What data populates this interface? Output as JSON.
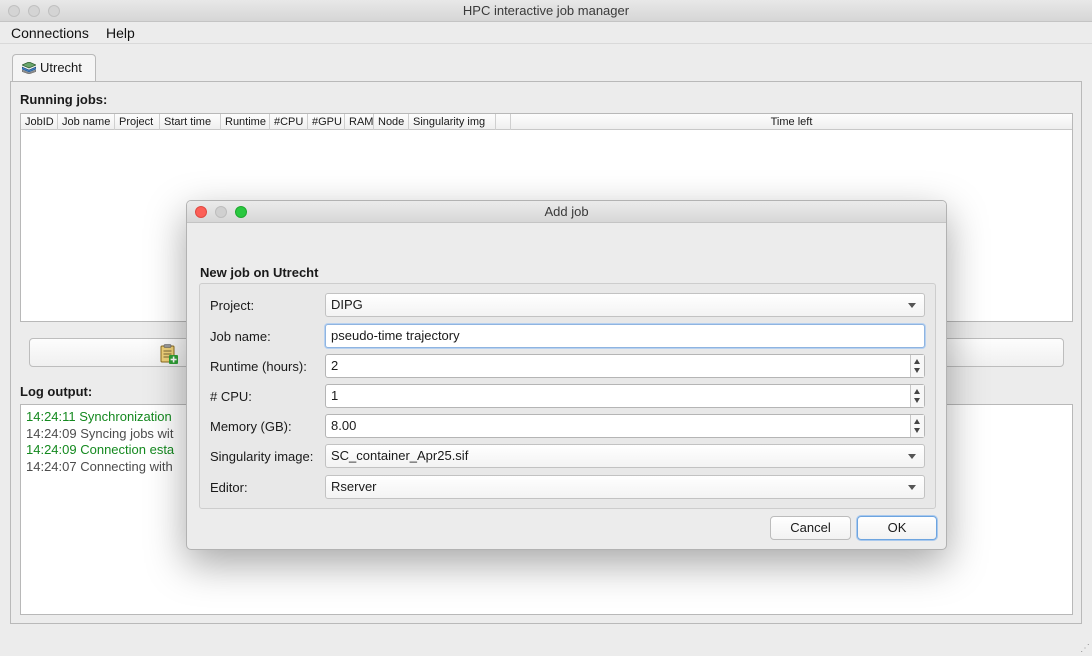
{
  "window": {
    "title": "HPC interactive job manager"
  },
  "menu": {
    "connections": "Connections",
    "help": "Help"
  },
  "tabs": [
    {
      "label": "Utrecht",
      "icon": "server-stack-icon"
    }
  ],
  "running_jobs": {
    "label": "Running jobs:",
    "columns": [
      "JobID",
      "Job name",
      "Project",
      "Start time",
      "Runtime",
      "#CPU",
      "#GPU",
      "RAM",
      "Node",
      "Singularity img",
      "",
      "Time left"
    ],
    "rows": []
  },
  "add_job_button": {
    "icon": "add-job-clipboard-icon"
  },
  "log": {
    "label": "Log output:",
    "lines": [
      {
        "text": "14:24:11 Synchronization",
        "color": "#14891f"
      },
      {
        "text": "14:24:09 Syncing jobs wit",
        "color": "#4d4d4d"
      },
      {
        "text": "14:24:09 Connection esta",
        "color": "#14891f"
      },
      {
        "text": "14:24:07 Connecting with",
        "color": "#4d4d4d"
      }
    ]
  },
  "dialog": {
    "title": "Add job",
    "group_label": "New job on Utrecht",
    "fields": {
      "project": {
        "label": "Project:",
        "value": "DIPG"
      },
      "job_name": {
        "label": "Job name:",
        "value": "pseudo-time trajectory"
      },
      "runtime": {
        "label": "Runtime (hours):",
        "value": "2"
      },
      "cpu": {
        "label": "# CPU:",
        "value": "1"
      },
      "memory": {
        "label": "Memory (GB):",
        "value": "8.00"
      },
      "singularity": {
        "label": "Singularity image:",
        "value": "SC_container_Apr25.sif"
      },
      "editor": {
        "label": "Editor:",
        "value": "Rserver"
      }
    },
    "cancel_label": "Cancel",
    "ok_label": "OK"
  },
  "colors": {
    "log_success": "#14891f",
    "log_info": "#4d4d4d",
    "close": "#fc5f57",
    "zoom": "#2ac840",
    "focus": "#8fb4e0"
  }
}
